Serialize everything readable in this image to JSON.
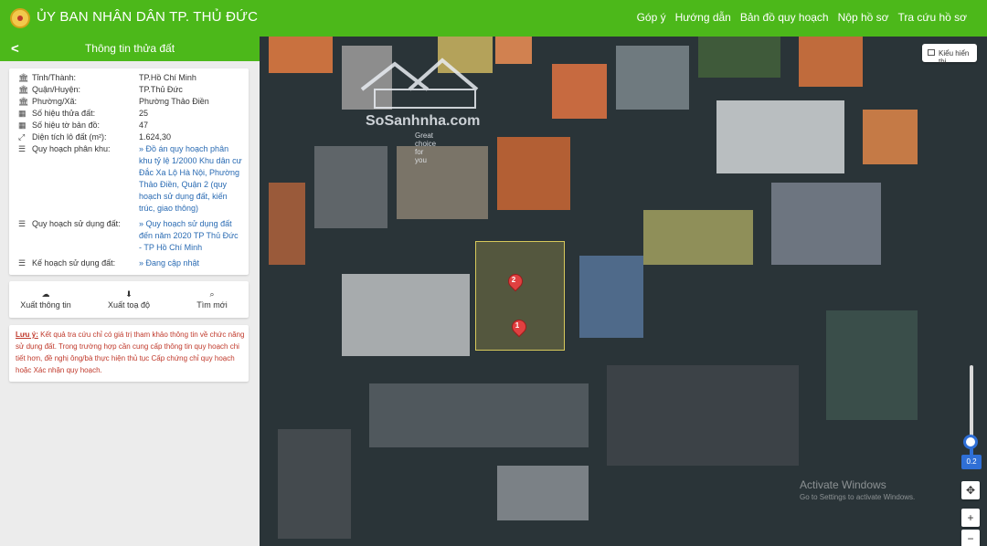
{
  "header": {
    "title": "ỦY BAN NHÂN DÂN TP. THỦ ĐỨC",
    "nav": [
      "Góp ý",
      "Hướng dẫn",
      "Bản đồ quy hoạch",
      "Nộp hồ sơ",
      "Tra cứu hồ sơ"
    ]
  },
  "sidebar": {
    "title": "Thông tin thửa đất",
    "info": [
      {
        "label": "Tỉnh/Thành:",
        "value": "TP.Hồ Chí Minh",
        "icon": "building-icon"
      },
      {
        "label": "Quận/Huyện:",
        "value": "TP.Thủ Đức",
        "icon": "building-icon"
      },
      {
        "label": "Phường/Xã:",
        "value": "Phường Thảo Điền",
        "icon": "building-icon"
      },
      {
        "label": "Số hiệu thửa đất:",
        "value": "25",
        "icon": "map-icon"
      },
      {
        "label": "Số hiệu tờ bản đồ:",
        "value": "47",
        "icon": "map-icon"
      },
      {
        "label": "Diện tích lô đất (m²):",
        "value": "1.624,30",
        "icon": "expand-icon"
      },
      {
        "label": "Quy hoạch phân khu:",
        "value": "»  Đồ án quy hoạch phân khu tỷ lệ 1/2000 Khu dân cư Đắc Xa Lộ Hà Nội, Phường Thảo Điền, Quận 2 (quy hoạch sử dụng đất, kiến trúc, giao thông)",
        "icon": "list-icon"
      },
      {
        "label": "Quy hoạch sử dụng đất:",
        "value": "»  Quy hoạch sử dụng đất đến năm 2020 TP Thủ Đức - TP Hồ Chí Minh",
        "icon": "list-icon"
      },
      {
        "label": "Kế hoạch sử dụng đất:",
        "value": "»  Đang cập nhật",
        "icon": "list-icon"
      }
    ],
    "actions": [
      {
        "label": "Xuất thông tin",
        "icon": "cloud-download-icon"
      },
      {
        "label": "Xuất toạ độ",
        "icon": "download-icon"
      },
      {
        "label": "Tìm mới",
        "icon": "search-icon"
      }
    ],
    "note_prefix": "Lưu ý:",
    "note": "Kết quả tra cứu chỉ có giá trị tham khảo thông tin về chức năng sử dụng đất. Trong trường hợp cần cung cấp thông tin quy hoạch chi tiết hơn, đề nghị ông/bà thực hiện thủ tục Cấp chứng chỉ quy hoạch hoặc Xác nhận quy hoạch."
  },
  "map": {
    "view_button": "Kiểu hiển thị",
    "zoom_value": "0.2",
    "watermark_brand": "SoSanhnha.com",
    "watermark_tag": "Great choice for you",
    "pins": [
      "2",
      "1"
    ],
    "windows_title": "Activate Windows",
    "windows_sub": "Go to Settings to activate Windows."
  },
  "colors": {
    "header": "#4cb81a",
    "link": "#2a6bb3",
    "note": "#c0392b",
    "accent": "#2f6fd6"
  }
}
